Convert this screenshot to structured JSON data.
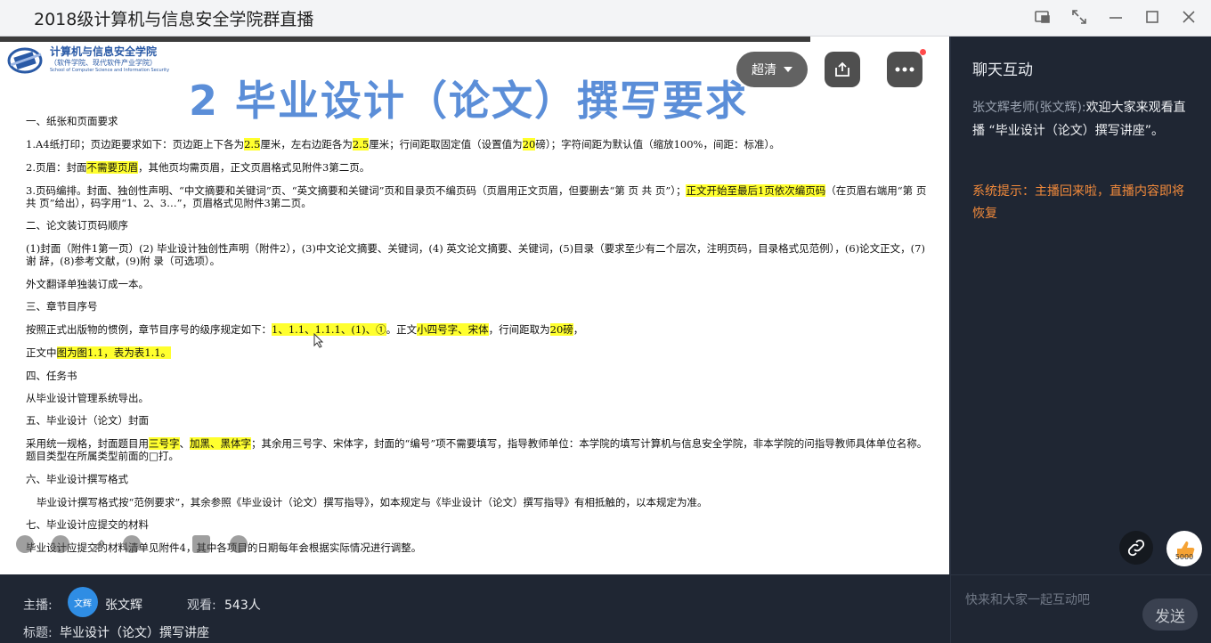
{
  "window": {
    "title": "2018级计算机与信息安全学院群直播"
  },
  "slide": {
    "logo_name": "计算机与信息安全学院",
    "logo_sub": "（软件学院、现代软件产业学院）",
    "logo_en": "School of Computer Science and Information Security",
    "heading": "2 毕业设计（论文）撰写要求",
    "lines": {
      "s1": "一、纸张和页面要求",
      "l1a": "1.A4纸打印；页边距要求如下：页边距上下各为",
      "l1b": "2.5",
      "l1c": "厘米，左右边距各为",
      "l1d": "2.5",
      "l1e": "厘米；行间距取固定值（设置值为",
      "l1f": "20",
      "l1g": "磅）；字符间距为默认值（缩放100%，间距：标准）。",
      "l2a": "2.页眉：封面",
      "l2b": "不需要页眉",
      "l2c": "，其他页均需页眉，正文页眉格式见附件3第二页。",
      "l3a": "3.页码编排。封面、独创性声明、“中文摘要和关键词”页、“英文摘要和关键词”页和目录页不编页码（页眉用正文页眉，但要删去“第 页 共 页”）；",
      "l3b": "正文开始至最后1页依次编页码",
      "l3c": "（在页眉右端用“第 页 共 页”给出），码字用“1、2、3…”，页眉格式见附件3第二页。",
      "s2": "二、论文装订页码顺序",
      "l4": "(1)封面（附件1第一页）(2) 毕业设计独创性声明（附件2），(3)中文论文摘要、关键词，(4) 英文论文摘要、关键词，(5)目录（要求至少有二个层次，注明页码，目录格式见范例），(6)论文正文，(7)谢 辞，(8)参考文献，(9)附 录（可选项）。",
      "l5": "外文翻译单独装订成一本。",
      "s3": "三、章节目序号",
      "l6a": "按照正式出版物的惯例，章节目序号的级序规定如下：",
      "l6b": "1、1.1、1.1.1、(1)、①",
      "l6c": "。正文",
      "l6d": "小四号字、宋体",
      "l6e": "，行间距取为",
      "l6f": "20磅",
      "l6g": "，",
      "l7a": "正文中",
      "l7b": "图为图1.1，表为表1.1。",
      "s4": "四、任务书",
      "l8": "从毕业设计管理系统导出。",
      "s5": "五、毕业设计（论文）封面",
      "l9a": "采用统一规格，封面题目用",
      "l9b": "三号字",
      "l9c": "、",
      "l9d": "加黑、黑体字",
      "l9e": "；其余用三号字、宋体字，封面的“编号”项不需要填写，指导教师单位：本学院的填写计算机与信息安全学院，非本学院的问指导教师具体单位名称。题目类型在所属类型前面的□打。",
      "s6": "六、毕业设计撰写格式",
      "l10": "毕业设计撰写格式按“范例要求”，其余参照《毕业设计（论文）撰写指导》，如本规定与《毕业设计（论文）撰写指导》有相抵触的，以本规定为准。",
      "s7": "七、毕业设计应提交的材料",
      "l11": "毕业设计应提交的材料清单见附件4，其中各项目的日期每年会根据实际情况进行调整。"
    }
  },
  "player": {
    "quality_label": "超清"
  },
  "info": {
    "host_label": "主播:",
    "host_avatar_text": "文辉",
    "host_name": "张文辉",
    "viewers_label": "观看:",
    "viewers_count": "543人",
    "topic_label": "标题:",
    "topic": "毕业设计（论文）撰写讲座"
  },
  "chat": {
    "header": "聊天互动",
    "message_author": "张文辉老师(张文辉):",
    "message_text": "欢迎大家来观看直播 “毕业设计（论文）撰写讲座”。",
    "system_notice": "系统提示：主播回来啦，直播内容即将恢复",
    "like_count": "5000",
    "input_placeholder": "快来和大家一起互动吧",
    "send_label": "发送"
  },
  "colors": {
    "highlight": "#ffff2e",
    "slide_heading": "#5b8ed8",
    "system_notice": "#f28a3b",
    "panel_bg": "#1f2633"
  }
}
